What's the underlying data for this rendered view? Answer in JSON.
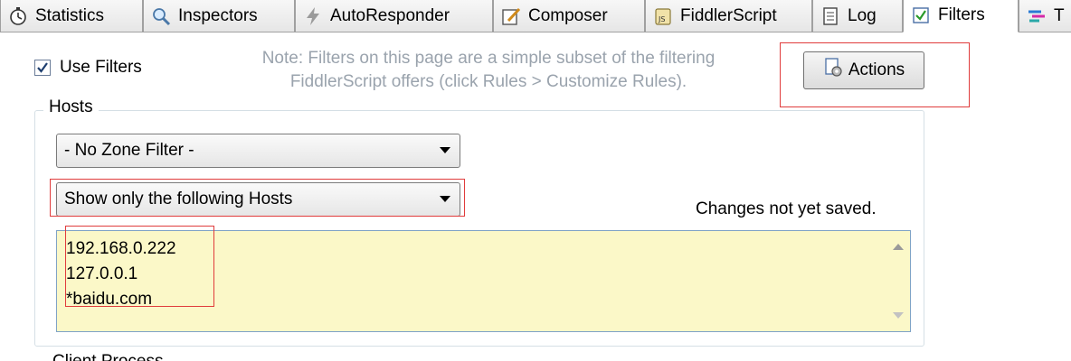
{
  "tabs": [
    {
      "label": "Statistics",
      "icon": "stopwatch-icon"
    },
    {
      "label": "Inspectors",
      "icon": "magnifier-icon"
    },
    {
      "label": "AutoResponder",
      "icon": "lightning-icon"
    },
    {
      "label": "Composer",
      "icon": "pencil-note-icon"
    },
    {
      "label": "FiddlerScript",
      "icon": "js-scroll-icon"
    },
    {
      "label": "Log",
      "icon": "log-page-icon"
    },
    {
      "label": "Filters",
      "icon": "checkbox-icon",
      "active": true
    },
    {
      "label": "T",
      "icon": "timeline-icon"
    }
  ],
  "filters": {
    "use_filters_label": "Use Filters",
    "use_filters_checked": true,
    "note_line1": "Note: Filters on this page are a simple subset of the filtering",
    "note_line2": "FiddlerScript offers (click Rules > Customize Rules).",
    "actions_label": "Actions"
  },
  "hosts": {
    "legend": "Hosts",
    "zone_filter": "- No Zone Filter -",
    "host_filter": "Show only the following Hosts",
    "status": "Changes not yet saved.",
    "host_list": [
      "192.168.0.222",
      "127.0.0.1",
      "*baidu.com"
    ],
    "next_section_label": "Client Process"
  },
  "colors": {
    "highlight_box": "#e03c3c",
    "host_list_bg": "#fbf8c8",
    "note_text": "#9aa3ad"
  }
}
